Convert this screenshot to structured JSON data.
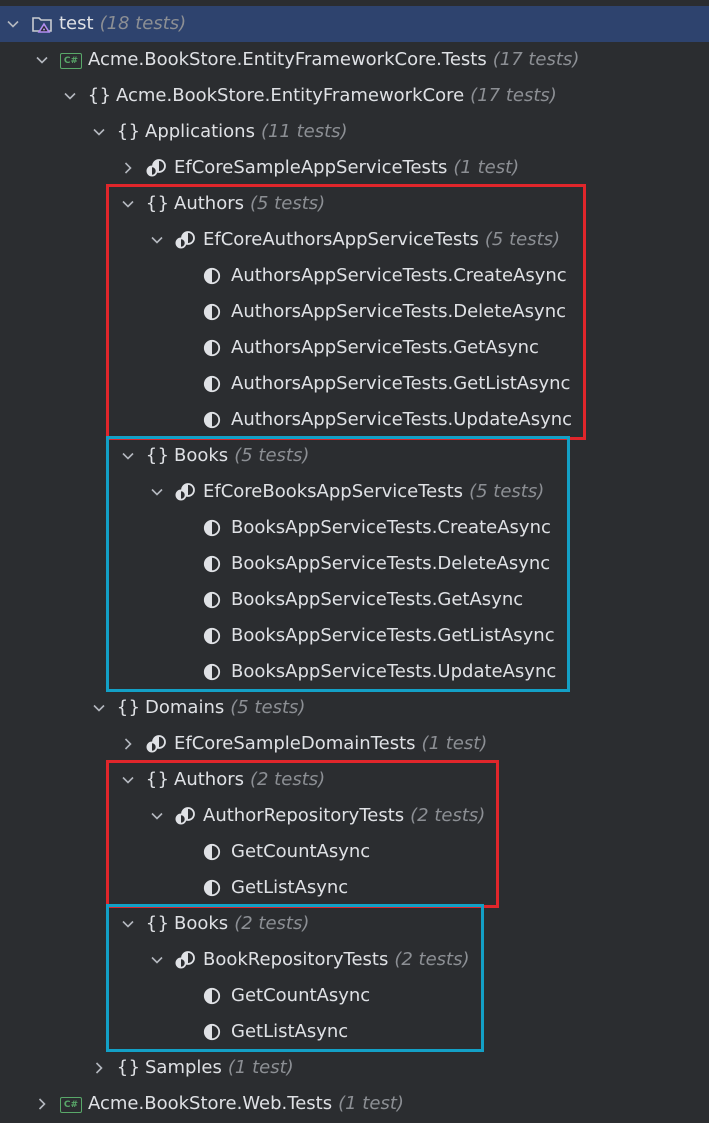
{
  "colors": {
    "background": "#2b2d30",
    "selection": "#2e436e",
    "highlight_red": "#e0262b",
    "highlight_blue": "#13a0c6",
    "count_text": "#8c8f94"
  },
  "tree": [
    {
      "label": "test",
      "count": "(18 tests)",
      "icon": "folder-test-icon",
      "expanded": true,
      "depth": 0,
      "selected": true
    },
    {
      "label": "Acme.BookStore.EntityFrameworkCore.Tests",
      "count": "(17 tests)",
      "icon": "csharp-project-icon",
      "expanded": true,
      "depth": 1
    },
    {
      "label": "Acme.BookStore.EntityFrameworkCore",
      "count": "(17 tests)",
      "icon": "namespace-icon",
      "expanded": true,
      "depth": 2
    },
    {
      "label": "Applications",
      "count": "(11 tests)",
      "icon": "namespace-icon",
      "expanded": true,
      "depth": 3
    },
    {
      "label": "EfCoreSampleAppServiceTests",
      "count": "(1 test)",
      "icon": "test-class-icon",
      "expanded": false,
      "depth": 4
    },
    {
      "label": "Authors",
      "count": "(5 tests)",
      "icon": "namespace-icon",
      "expanded": true,
      "depth": 4
    },
    {
      "label": "EfCoreAuthorsAppServiceTests",
      "count": "(5 tests)",
      "icon": "test-class-icon",
      "expanded": true,
      "depth": 5
    },
    {
      "label": "AuthorsAppServiceTests.CreateAsync",
      "count": "",
      "icon": "test-method-icon",
      "depth": 6
    },
    {
      "label": "AuthorsAppServiceTests.DeleteAsync",
      "count": "",
      "icon": "test-method-icon",
      "depth": 6
    },
    {
      "label": "AuthorsAppServiceTests.GetAsync",
      "count": "",
      "icon": "test-method-icon",
      "depth": 6
    },
    {
      "label": "AuthorsAppServiceTests.GetListAsync",
      "count": "",
      "icon": "test-method-icon",
      "depth": 6
    },
    {
      "label": "AuthorsAppServiceTests.UpdateAsync",
      "count": "",
      "icon": "test-method-icon",
      "depth": 6
    },
    {
      "label": "Books",
      "count": "(5 tests)",
      "icon": "namespace-icon",
      "expanded": true,
      "depth": 4
    },
    {
      "label": "EfCoreBooksAppServiceTests",
      "count": "(5 tests)",
      "icon": "test-class-icon",
      "expanded": true,
      "depth": 5
    },
    {
      "label": "BooksAppServiceTests.CreateAsync",
      "count": "",
      "icon": "test-method-icon",
      "depth": 6
    },
    {
      "label": "BooksAppServiceTests.DeleteAsync",
      "count": "",
      "icon": "test-method-icon",
      "depth": 6
    },
    {
      "label": "BooksAppServiceTests.GetAsync",
      "count": "",
      "icon": "test-method-icon",
      "depth": 6
    },
    {
      "label": "BooksAppServiceTests.GetListAsync",
      "count": "",
      "icon": "test-method-icon",
      "depth": 6
    },
    {
      "label": "BooksAppServiceTests.UpdateAsync",
      "count": "",
      "icon": "test-method-icon",
      "depth": 6
    },
    {
      "label": "Domains",
      "count": "(5 tests)",
      "icon": "namespace-icon",
      "expanded": true,
      "depth": 3
    },
    {
      "label": "EfCoreSampleDomainTests",
      "count": "(1 test)",
      "icon": "test-class-icon",
      "expanded": false,
      "depth": 4
    },
    {
      "label": "Authors",
      "count": "(2 tests)",
      "icon": "namespace-icon",
      "expanded": true,
      "depth": 4
    },
    {
      "label": "AuthorRepositoryTests",
      "count": "(2 tests)",
      "icon": "test-class-icon",
      "expanded": true,
      "depth": 5
    },
    {
      "label": "GetCountAsync",
      "count": "",
      "icon": "test-method-icon",
      "depth": 6
    },
    {
      "label": "GetListAsync",
      "count": "",
      "icon": "test-method-icon",
      "depth": 6
    },
    {
      "label": "Books",
      "count": "(2 tests)",
      "icon": "namespace-icon",
      "expanded": true,
      "depth": 4
    },
    {
      "label": "BookRepositoryTests",
      "count": "(2 tests)",
      "icon": "test-class-icon",
      "expanded": true,
      "depth": 5
    },
    {
      "label": "GetCountAsync",
      "count": "",
      "icon": "test-method-icon",
      "depth": 6
    },
    {
      "label": "GetListAsync",
      "count": "",
      "icon": "test-method-icon",
      "depth": 6
    },
    {
      "label": "Samples",
      "count": "(1 test)",
      "icon": "namespace-icon",
      "expanded": false,
      "depth": 3
    },
    {
      "label": "Acme.BookStore.Web.Tests",
      "count": "(1 test)",
      "icon": "csharp-project-icon",
      "expanded": false,
      "depth": 1
    }
  ],
  "highlights": [
    {
      "color": "red",
      "from": 5,
      "to": 11
    },
    {
      "color": "blue",
      "from": 12,
      "to": 18
    },
    {
      "color": "red",
      "from": 21,
      "to": 24
    },
    {
      "color": "blue",
      "from": 25,
      "to": 28
    }
  ]
}
